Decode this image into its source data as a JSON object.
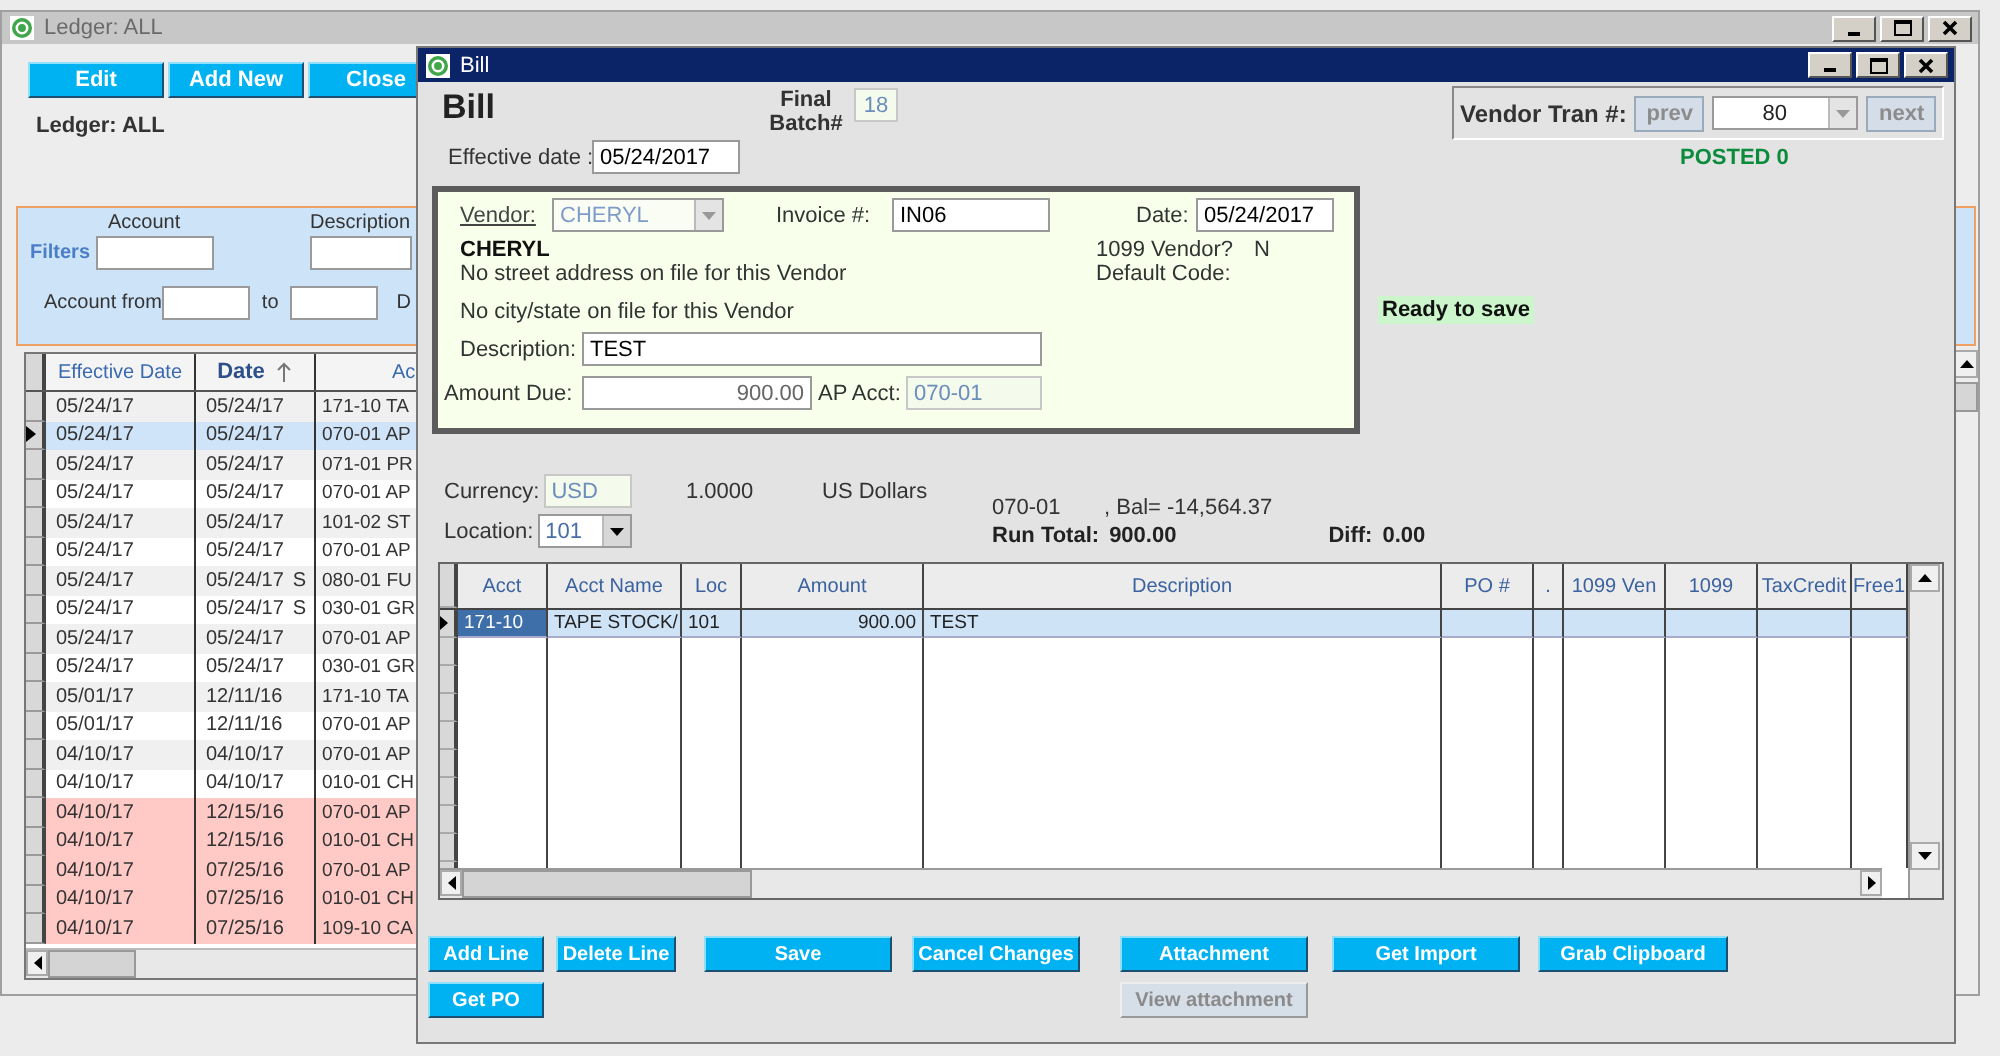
{
  "ledger_window": {
    "title": "Ledger: ALL",
    "buttons": [
      "Edit",
      "Add New",
      "Close"
    ],
    "heading": "Ledger: ALL",
    "filters": {
      "label": "Filters",
      "account_label": "Account",
      "description_label": "Description",
      "account_from_label": "Account from",
      "to_label": "to",
      "label_5": "D"
    },
    "grid": {
      "columns": [
        {
          "label": "Effective Date",
          "sorted": false
        },
        {
          "label": "Date",
          "sorted": true
        },
        {
          "label": "Ac",
          "sorted": false
        }
      ],
      "rows": [
        {
          "effective_date": "05/24/17",
          "date": "05/24/17",
          "account": "171-10 TA",
          "selected": false,
          "highlighted": false
        },
        {
          "effective_date": "05/24/17",
          "date": "05/24/17",
          "account": "070-01 AP",
          "selected": true,
          "highlighted": false
        },
        {
          "effective_date": "05/24/17",
          "date": "05/24/17",
          "account": "071-01 PR",
          "selected": false,
          "highlighted": false
        },
        {
          "effective_date": "05/24/17",
          "date": "05/24/17",
          "account": "070-01 AP",
          "selected": false,
          "highlighted": false
        },
        {
          "effective_date": "05/24/17",
          "date": "05/24/17",
          "account": "101-02 ST",
          "selected": false,
          "highlighted": false
        },
        {
          "effective_date": "05/24/17",
          "date": "05/24/17",
          "account": "070-01 AP",
          "selected": false,
          "highlighted": false
        },
        {
          "effective_date": "05/24/17",
          "date": "05/24/17",
          "flag": "S",
          "account": "080-01 FU",
          "selected": false,
          "highlighted": false
        },
        {
          "effective_date": "05/24/17",
          "date": "05/24/17",
          "flag": "S",
          "account": "030-01 GR",
          "selected": false,
          "highlighted": false
        },
        {
          "effective_date": "05/24/17",
          "date": "05/24/17",
          "account": "070-01 AP",
          "selected": false,
          "highlighted": false
        },
        {
          "effective_date": "05/24/17",
          "date": "05/24/17",
          "account": "030-01 GR",
          "selected": false,
          "highlighted": false
        },
        {
          "effective_date": "05/01/17",
          "date": "12/11/16",
          "account": "171-10 TA",
          "selected": false,
          "highlighted": false
        },
        {
          "effective_date": "05/01/17",
          "date": "12/11/16",
          "account": "070-01 AP",
          "selected": false,
          "highlighted": false
        },
        {
          "effective_date": "04/10/17",
          "date": "04/10/17",
          "account": "070-01 AP",
          "selected": false,
          "highlighted": false
        },
        {
          "effective_date": "04/10/17",
          "date": "04/10/17",
          "account": "010-01 CH",
          "selected": false,
          "highlighted": false
        },
        {
          "effective_date": "04/10/17",
          "date": "12/15/16",
          "account": "070-01 AP",
          "selected": false,
          "highlighted": true
        },
        {
          "effective_date": "04/10/17",
          "date": "12/15/16",
          "account": "010-01 CH",
          "selected": false,
          "highlighted": true
        },
        {
          "effective_date": "04/10/17",
          "date": "07/25/16",
          "account": "070-01 AP",
          "selected": false,
          "highlighted": true
        },
        {
          "effective_date": "04/10/17",
          "date": "07/25/16",
          "account": "010-01 CH",
          "selected": false,
          "highlighted": true
        },
        {
          "effective_date": "04/10/17",
          "date": "07/25/16",
          "account": "109-10 CA",
          "selected": false,
          "highlighted": true
        }
      ]
    }
  },
  "bill_window": {
    "title": "Bill",
    "heading": "Bill",
    "batch": {
      "label": "Final Batch#",
      "value": "18"
    },
    "effective_date": {
      "label": "Effective date :",
      "value": "05/24/2017"
    },
    "vendor_tran": {
      "label": "Vendor Tran #:",
      "prev": {
        "label": "prev",
        "disabled": true
      },
      "value": "80",
      "next": {
        "label": "next",
        "disabled": true
      },
      "status": "POSTED 0"
    },
    "vendor_panel": {
      "vendor": {
        "label": "Vendor:",
        "value": "CHERYL",
        "disabled": true
      },
      "invoice": {
        "label": "Invoice #:",
        "value": "IN06"
      },
      "date": {
        "label": "Date:",
        "value": "05/24/2017"
      },
      "vendor_name": "CHERYL",
      "address_line": "No street address on file for this Vendor",
      "city_line": "No city/state on file for this Vendor",
      "vendor_1099": {
        "label": "1099 Vendor?",
        "value": "N"
      },
      "default_code": {
        "label": "Default Code:"
      },
      "description": {
        "label": "Description:",
        "value": "TEST"
      },
      "amount_due": {
        "label": "Amount Due:",
        "value": "900.00"
      },
      "ap_acct": {
        "label": "AP Acct:",
        "value": "070-01",
        "disabled": true
      }
    },
    "save_status": "Ready to save",
    "currency": {
      "label": "Currency:",
      "value": "USD",
      "rate": "1.0000",
      "name": "US Dollars",
      "disabled": true
    },
    "location": {
      "label": "Location:",
      "value": "101"
    },
    "balance": {
      "account": "070-01",
      "text": ", Bal= -14,564.37"
    },
    "run_total": {
      "label": "Run Total:",
      "value": "900.00"
    },
    "diff": {
      "label": "Diff:",
      "value": "0.00"
    },
    "lines": {
      "columns": [
        "Acct",
        "Acct Name",
        "Loc",
        "Amount",
        "Description",
        "PO #",
        ".",
        "1099 Ven",
        "1099",
        "TaxCredit",
        "Free1"
      ],
      "rows": [
        {
          "cells": [
            "171-10",
            "TAPE STOCK/",
            "101",
            "900.00",
            "TEST"
          ],
          "selected": true
        }
      ]
    },
    "buttons": [
      {
        "label": "Add Line",
        "disabled": false
      },
      {
        "label": "Delete Line",
        "disabled": false
      },
      {
        "label": "Save",
        "disabled": false
      },
      {
        "label": "Cancel Changes",
        "disabled": false
      },
      {
        "label": "Attachment",
        "disabled": false
      },
      {
        "label": "Get Import",
        "disabled": false
      },
      {
        "label": "Grab Clipboard",
        "disabled": false
      }
    ],
    "buttons_row_2": [
      {
        "label": "Get PO",
        "disabled": false
      },
      {
        "label": "View attachment",
        "disabled": true
      }
    ]
  }
}
